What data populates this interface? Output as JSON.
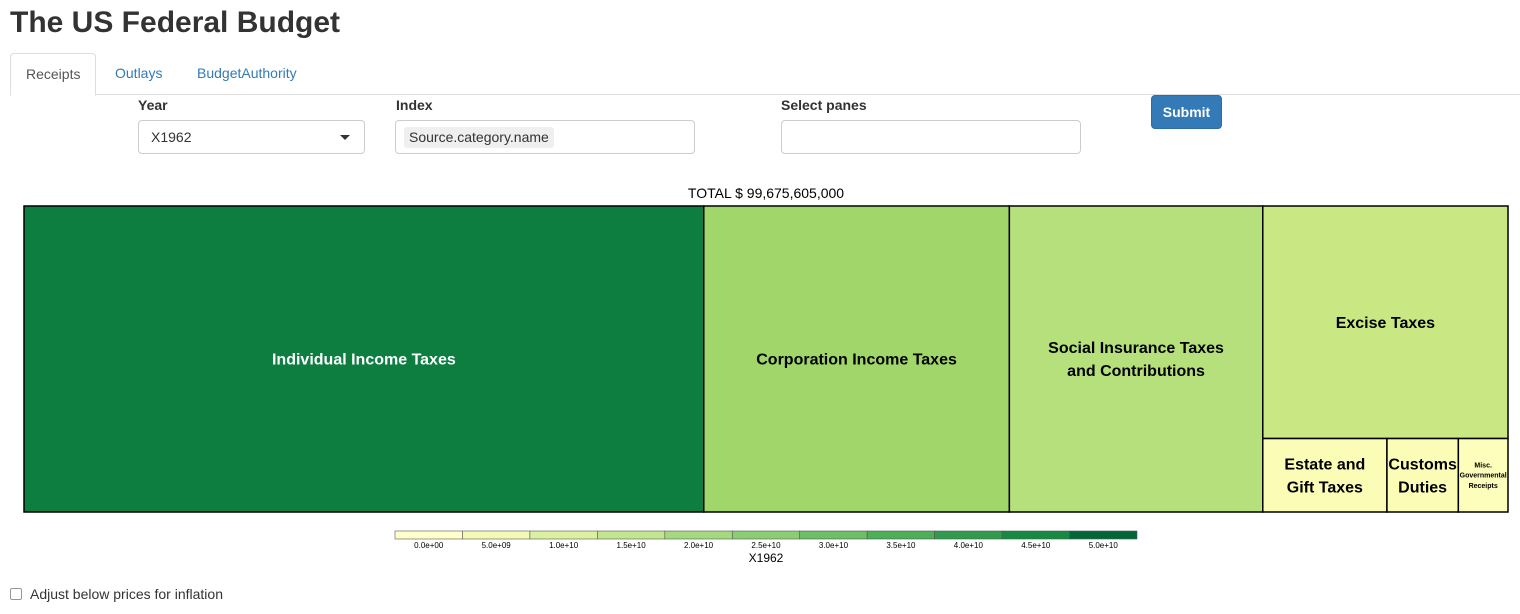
{
  "app": {
    "title": "The US Federal Budget"
  },
  "tabs": [
    {
      "label": "Receipts",
      "active": true
    },
    {
      "label": "Outlays",
      "active": false
    },
    {
      "label": "BudgetAuthority",
      "active": false
    }
  ],
  "controls": {
    "year_label": "Year",
    "year_value": "X1962",
    "index_label": "Index",
    "index_value": "Source.category.name",
    "panes_label": "Select panes",
    "panes_value": "",
    "submit_label": "Submit"
  },
  "total_label": "TOTAL $ 99,675,605,000",
  "colors": {
    "accent": "#337ab7",
    "scale": [
      "#ffffcc",
      "#f7fcb9",
      "#d9f0a3",
      "#addd8e",
      "#78c679",
      "#41ab5d",
      "#238443",
      "#006837"
    ]
  },
  "chart_data": {
    "type": "treemap",
    "title": "TOTAL $ 99,675,605,000",
    "value_variable": "X1962",
    "approximate": true,
    "items": [
      {
        "label": "Individual Income Taxes",
        "lines": [
          "Individual Income Taxes"
        ],
        "value": 45600000000,
        "color": "#0d7d40",
        "text_color": "#ffffff",
        "font_size": 16
      },
      {
        "label": "Corporation Income Taxes",
        "lines": [
          "Corporation Income Taxes"
        ],
        "value": 20500000000,
        "color": "#a1d76a",
        "text_color": "#000000",
        "font_size": 16
      },
      {
        "label": "Social Insurance Taxes and Contributions",
        "lines": [
          "Social Insurance Taxes",
          "and Contributions"
        ],
        "value": 17000000000,
        "color": "#b5e07b",
        "text_color": "#000000",
        "font_size": 16
      },
      {
        "label": "Excise Taxes",
        "lines": [
          "Excise Taxes"
        ],
        "value": 12500000000,
        "color": "#c9e883",
        "text_color": "#000000",
        "font_size": 16
      },
      {
        "label": "Estate and Gift Taxes",
        "lines": [
          "Estate and",
          "Gift Taxes"
        ],
        "value": 2000000000,
        "color": "#fbfcb6",
        "text_color": "#000000",
        "font_size": 16
      },
      {
        "label": "Customs Duties",
        "lines": [
          "Customs",
          "Duties"
        ],
        "value": 1150000000,
        "color": "#fbfcb6",
        "text_color": "#000000",
        "font_size": 16
      },
      {
        "label": "Misc. Governmental Receipts",
        "lines": [
          "Misc.",
          "Governmental",
          "Receipts"
        ],
        "value": 800000000,
        "color": "#fdfdbc",
        "text_color": "#000000",
        "font_size": 7
      }
    ],
    "legend": {
      "ticks": [
        "0.0e+00",
        "5.0e+09",
        "1.0e+10",
        "1.5e+10",
        "2.0e+10",
        "2.5e+10",
        "3.0e+10",
        "3.5e+10",
        "4.0e+10",
        "4.5e+10",
        "5.0e+10"
      ],
      "colors": [
        "#ffffcc",
        "#f3fab6",
        "#dbf0a0",
        "#c2e68d",
        "#a6d97f",
        "#8acd72",
        "#6cbf65",
        "#4daf58",
        "#2e9c4c",
        "#168a41",
        "#006837"
      ],
      "caption": "X1962"
    }
  },
  "footer": {
    "inflation_label": "Adjust below prices for inflation",
    "inflation_checked": false
  }
}
